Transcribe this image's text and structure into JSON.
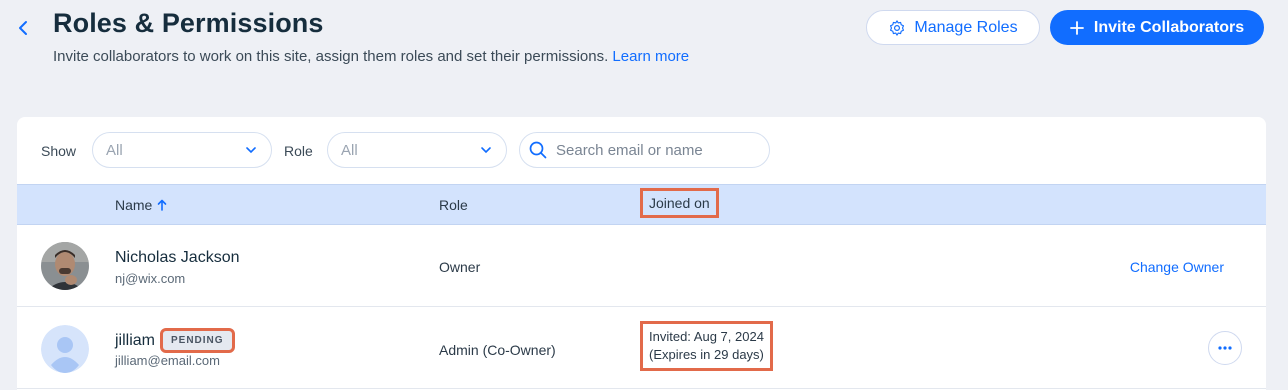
{
  "header": {
    "title": "Roles & Permissions",
    "subtitle": "Invite collaborators to work on this site, assign them roles and set their permissions.",
    "learn_more": "Learn more",
    "manage_roles": "Manage Roles",
    "invite_collaborators": "Invite Collaborators"
  },
  "filters": {
    "show_label": "Show",
    "show_value": "All",
    "role_label": "Role",
    "role_value": "All",
    "search_placeholder": "Search email or name"
  },
  "table": {
    "columns": {
      "name": "Name",
      "role": "Role",
      "joined": "Joined on"
    },
    "sort_icon": "arrow-up-icon",
    "rows": [
      {
        "name": "Nicholas Jackson",
        "email": "nj@wix.com",
        "role": "Owner",
        "action": "Change Owner"
      },
      {
        "name": "jilliam",
        "badge": "PENDING",
        "email": "jilliam@email.com",
        "role": "Admin (Co-Owner)",
        "invited": "Invited: Aug 7, 2024",
        "expires": "(Expires in 29 days)"
      }
    ]
  },
  "colors": {
    "accent": "#116dff",
    "highlight": "#e26a4a",
    "header_bg": "#d3e3fd"
  }
}
